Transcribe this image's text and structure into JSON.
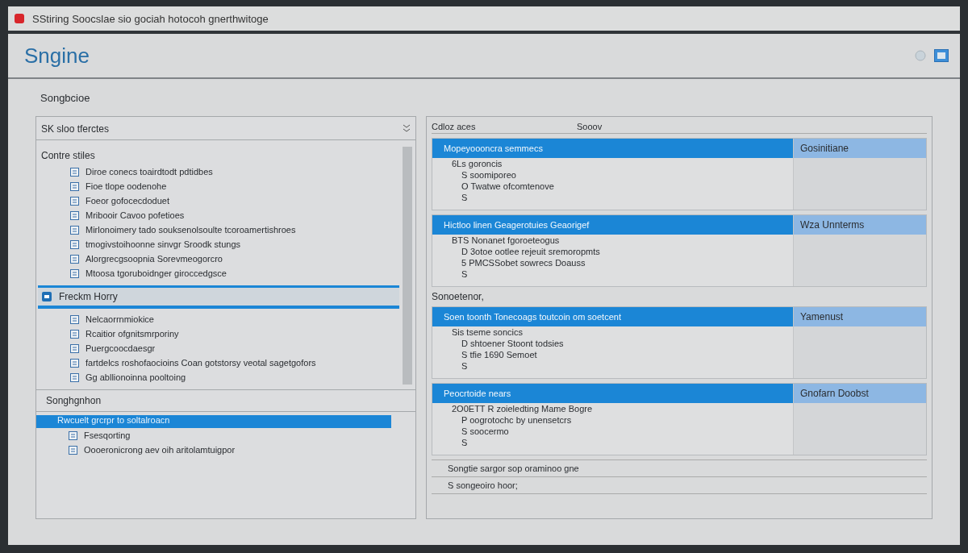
{
  "window": {
    "title": "SStiring Soocslae sio gociah hotocoh gnerthwitoge"
  },
  "header": {
    "logo": "Sngine"
  },
  "section_title": "Songbcioe",
  "left_panel": {
    "title": "SK sloo tferctes",
    "groups": [
      {
        "label": "Contre stiles",
        "selected": false,
        "items": [
          "Diroe conecs toairdtodt pdtidbes",
          "Fioe tlope oodenohe",
          "Foeor gofocecdoduet",
          "Mribooir Cavoo pofetioes",
          "Mirlonoimery tado souksenolsoulte tcoroamertishroes",
          "tmogivstoihoonne sinvgr Sroodk stungs",
          "Alorgrecgsoopnia Sorevmeogorcro",
          "Mtoosa tgoruboidnger giroccedgsce"
        ]
      },
      {
        "label": "Freckm Horry",
        "selected": true,
        "items": [
          "Nelcaorrnmiokice",
          "Rcaitior ofgnitsmrporiny",
          "Puergcoocdaesgr",
          "fartdelcs roshofaocioins Coan gotstorsy veotal sagetgofors",
          "Gg abllionoinna pooltoing"
        ]
      }
    ],
    "section_row": "Songhgnhon",
    "lower_group": {
      "label": "Rwcuelt grcrpr to soltalroacn",
      "selected": true,
      "items": [
        "Fsesqorting",
        "Oooeronicrong aev oih aritolamtuigpor"
      ]
    }
  },
  "right_panel": {
    "title": "Cdloz aces",
    "column_2": "Sooov",
    "cards": [
      {
        "title": "Mopeyoooncra semmecs",
        "side": "Gosinitiane",
        "lines": [
          "6Ls goroncis",
          "S soomiporeo",
          "O Twatwe ofcomtenove",
          "S"
        ]
      },
      {
        "title": "Hictloo linen Geagerotuies Geaorigef",
        "side": "Wza Unnterms",
        "lines": [
          "BTS Nonanet fgoroeteogus",
          "D 3otoe ootlee rejeuit sremoropmts",
          "5 PMCSSobet sowrecs Doauss",
          "S"
        ]
      },
      {
        "label": "Sonoetenor,",
        "title": "Soen toonth Tonecoags toutcoin om soetcent",
        "side": "Yamenust",
        "lines": [
          "Sis tseme soncics",
          "D shtoener Stoont todsies",
          "S tfie 1690 Semoet",
          "S"
        ]
      },
      {
        "title": "Peocrtoide nears",
        "side": "Gnofarn Doobst",
        "lines": [
          "2O0ETT R zoieledting Mame Bogre",
          "P oogrotochc by unensetcrs",
          "S soocermo",
          "S"
        ]
      }
    ],
    "footer_rows": [
      "Songtie sargor sop oraminoo gne",
      "S songeoiro hoor;"
    ]
  }
}
